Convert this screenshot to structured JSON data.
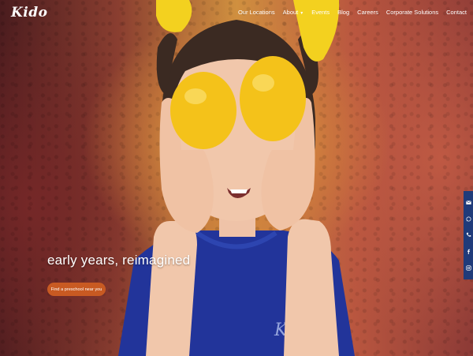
{
  "brand": {
    "logo_text": "Kido"
  },
  "nav": {
    "items": [
      {
        "label": "Our Locations",
        "dropdown": false
      },
      {
        "label": "About",
        "dropdown": true
      },
      {
        "label": "Events",
        "dropdown": false
      },
      {
        "label": "Blog",
        "dropdown": false
      },
      {
        "label": "Careers",
        "dropdown": false
      },
      {
        "label": "Corporate Solutions",
        "dropdown": false
      },
      {
        "label": "Contact",
        "dropdown": false
      }
    ]
  },
  "hero": {
    "headline": "early years, reimagined",
    "cta_label": "Find a preschool near you",
    "shirt_logo": "Kido"
  },
  "social": {
    "icons": [
      "email-icon",
      "whatsapp-icon",
      "phone-icon",
      "facebook-icon",
      "instagram-icon"
    ]
  },
  "colors": {
    "cta_bg": "#c85a22",
    "social_bar_bg": "#1f3b7a",
    "shirt_blue": "#22349a",
    "lemon": "#f4c21a",
    "bow_yellow": "#f3d11f"
  }
}
